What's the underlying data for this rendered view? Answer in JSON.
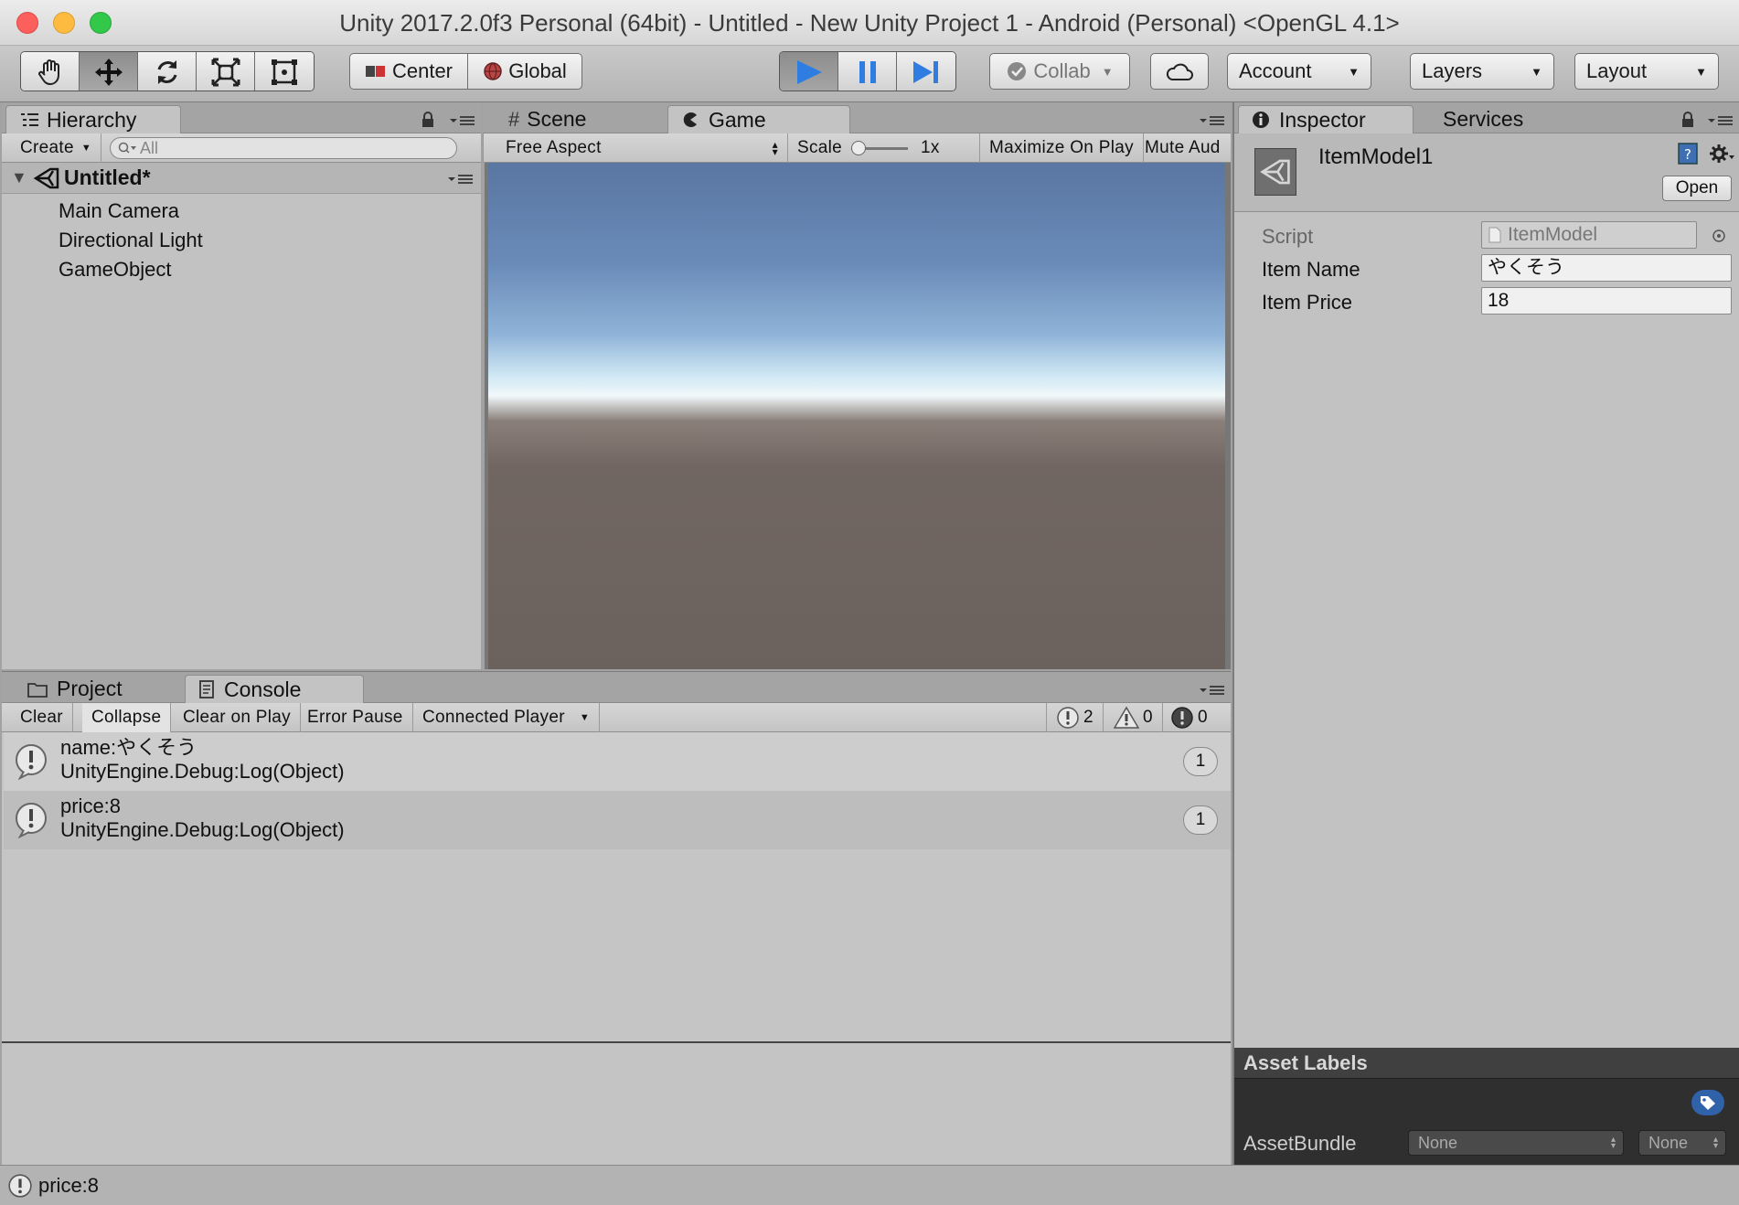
{
  "window": {
    "title": "Unity 2017.2.0f3 Personal (64bit) - Untitled - New Unity Project 1 - Android (Personal) <OpenGL 4.1>"
  },
  "toolbar": {
    "pivot_label": "Center",
    "space_label": "Global",
    "collab_label": "Collab",
    "account_label": "Account",
    "layers_label": "Layers",
    "layout_label": "Layout"
  },
  "hierarchy": {
    "tab_label": "Hierarchy",
    "create_label": "Create",
    "search_placeholder": "All",
    "scene_name": "Untitled*",
    "items": [
      "Main Camera",
      "Directional Light",
      "GameObject"
    ]
  },
  "center": {
    "scene_tab": "Scene",
    "game_tab": "Game",
    "aspect_label": "Free Aspect",
    "scale_label": "Scale",
    "scale_value": "1x",
    "maximize_label": "Maximize On Play",
    "mute_label": "Mute Aud"
  },
  "console": {
    "project_tab": "Project",
    "console_tab": "Console",
    "clear_label": "Clear",
    "collapse_label": "Collapse",
    "clear_on_play_label": "Clear on Play",
    "error_pause_label": "Error Pause",
    "connected_player_label": "Connected Player",
    "info_count": "2",
    "warning_count": "0",
    "error_count": "0",
    "entries": [
      {
        "line1": "name:やくそう",
        "line2": "UnityEngine.Debug:Log(Object)",
        "count": "1"
      },
      {
        "line1": "price:8",
        "line2": "UnityEngine.Debug:Log(Object)",
        "count": "1"
      }
    ]
  },
  "inspector": {
    "tab_label": "Inspector",
    "services_tab": "Services",
    "object_name": "ItemModel1",
    "open_label": "Open",
    "fields": [
      {
        "label": "Script",
        "value": "ItemModel"
      },
      {
        "label": "Item Name",
        "value": "やくそう"
      },
      {
        "label": "Item Price",
        "value": "18"
      }
    ],
    "asset_labels_title": "Asset Labels",
    "assetbundle_label": "AssetBundle",
    "assetbundle_value": "None",
    "assetbundle_variant": "None"
  },
  "statusbar": {
    "message": "price:8"
  },
  "colors": {
    "play_blue": "#2f7de1",
    "panel_bg": "#c2c2c2",
    "asset_labels_bg": "#2f2f2f"
  }
}
